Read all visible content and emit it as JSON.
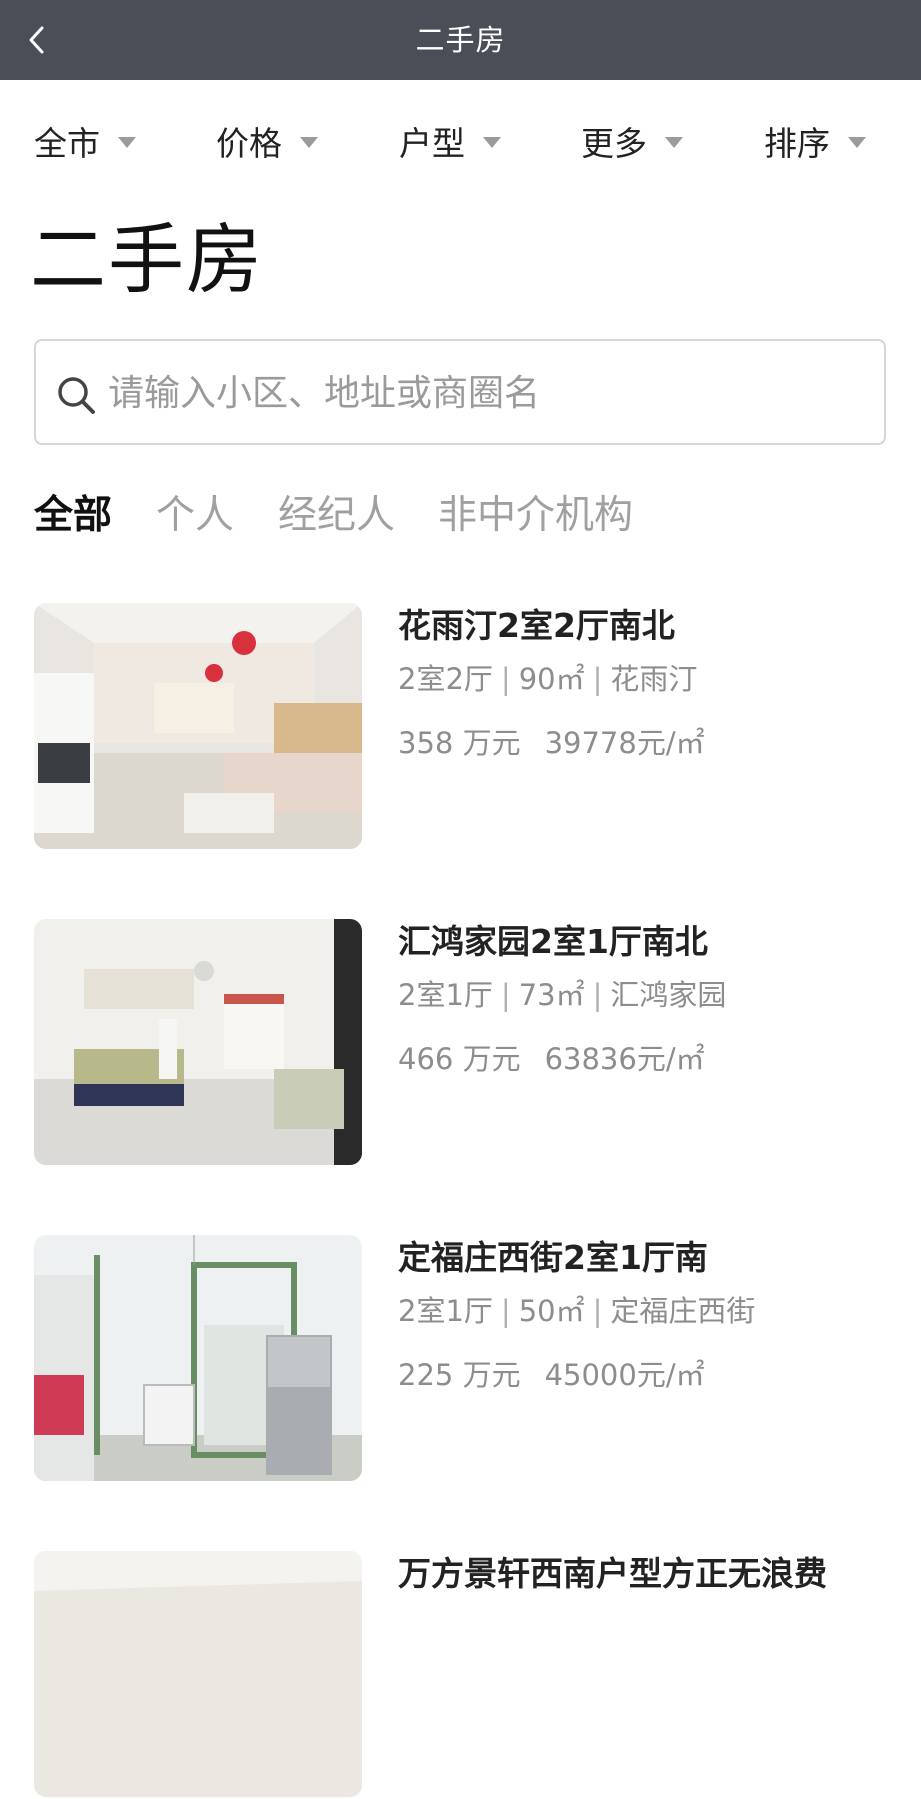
{
  "header": {
    "title": "二手房"
  },
  "filters": [
    {
      "label": "全市"
    },
    {
      "label": "价格"
    },
    {
      "label": "户型"
    },
    {
      "label": "更多"
    },
    {
      "label": "排序"
    }
  ],
  "page": {
    "heading": "二手房"
  },
  "search": {
    "placeholder": "请输入小区、地址或商圈名",
    "value": ""
  },
  "tabs": [
    {
      "label": "全部",
      "active": true
    },
    {
      "label": "个人",
      "active": false
    },
    {
      "label": "经纪人",
      "active": false
    },
    {
      "label": "非中介机构",
      "active": false
    }
  ],
  "listings": [
    {
      "title": "花雨汀2室2厅南北",
      "layout": "2室2厅",
      "area": "90㎡",
      "community": "花雨汀",
      "total_price": "358 万元",
      "unit_price": "39778元/㎡"
    },
    {
      "title": "汇鸿家园2室1厅南北",
      "layout": "2室1厅",
      "area": "73㎡",
      "community": "汇鸿家园",
      "total_price": "466 万元",
      "unit_price": "63836元/㎡"
    },
    {
      "title": "定福庄西街2室1厅南",
      "layout": "2室1厅",
      "area": "50㎡",
      "community": "定福庄西街",
      "total_price": "225 万元",
      "unit_price": "45000元/㎡"
    },
    {
      "title": "万方景轩西南户型方正无浪费"
    }
  ],
  "colors": {
    "topbar": "#4a4f57",
    "text_primary": "#111111",
    "text_secondary": "#8d8d8d",
    "tab_inactive": "#a0a0a0"
  }
}
